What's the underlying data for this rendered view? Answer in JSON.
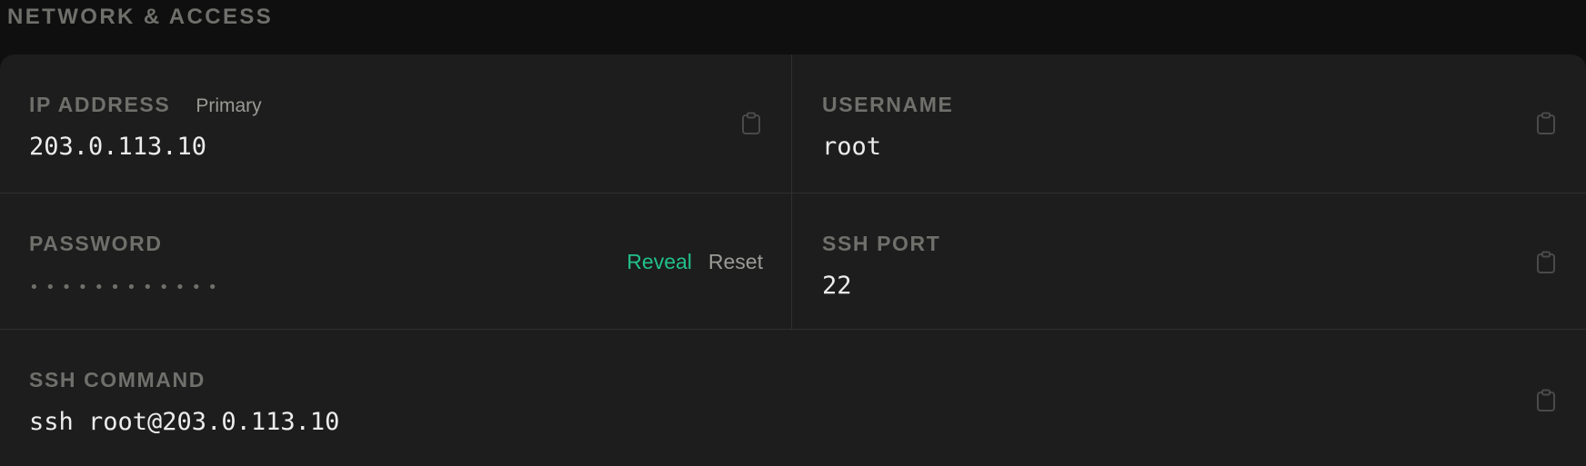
{
  "section": {
    "title": "NETWORK & ACCESS"
  },
  "fields": {
    "ip": {
      "label": "IP ADDRESS",
      "tag": "Primary",
      "value": "203.0.113.10"
    },
    "username": {
      "label": "USERNAME",
      "value": "root"
    },
    "password": {
      "label": "PASSWORD",
      "masked_value": "••••••••••••",
      "reveal_label": "Reveal",
      "reset_label": "Reset"
    },
    "ssh_port": {
      "label": "SSH PORT",
      "value": "22"
    },
    "ssh_command": {
      "label": "SSH COMMAND",
      "value": "ssh root@203.0.113.10"
    }
  },
  "icons": {
    "copy": "clipboard-icon"
  },
  "colors": {
    "background": "#0f0f0f",
    "panel": "#1d1d1d",
    "divider": "#2f2f2f",
    "label": "#6f6f6b",
    "value": "#ececec",
    "accent": "#22c08a",
    "secondary_action": "#9a9a96"
  }
}
